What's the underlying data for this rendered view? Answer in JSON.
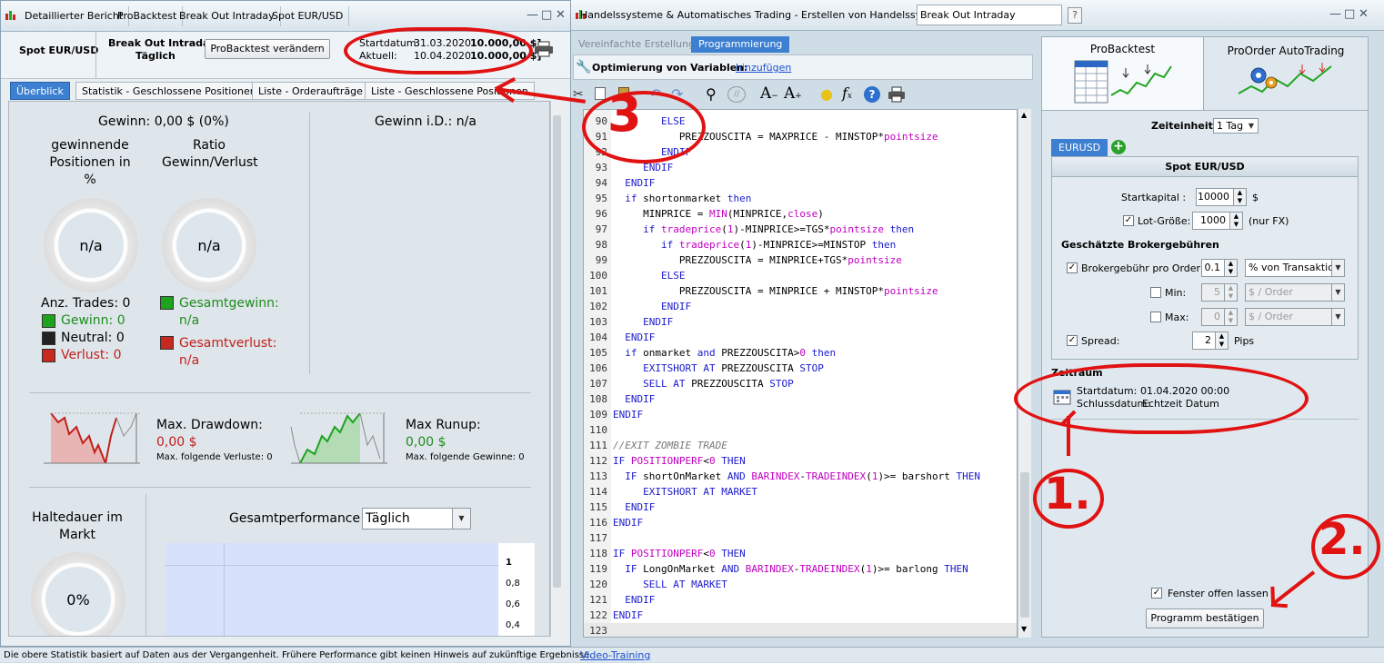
{
  "left_window": {
    "tabs": [
      "Detaillierter Bericht",
      "ProBacktest",
      "Break Out Intraday",
      "Spot EUR/USD"
    ],
    "instrument": "Spot EUR/USD",
    "system_name": "Break Out Intraday",
    "period": "Täglich",
    "modify_button": "ProBacktest verändern",
    "start_label": "Startdatum:",
    "start_value": "31.03.2020",
    "current_label": "Aktuell:",
    "current_value": "10.04.2020",
    "capital_1": "10.000,00 $]",
    "capital_2": "10.000,00 $]",
    "subtabs": [
      "Überblick",
      "Statistik - Geschlossene Positionen",
      "Liste - Orderaufträge",
      "Liste - Geschlossene Positionen"
    ],
    "gain": "Gewinn: 0,00 $ (0%)",
    "gain_id": "Gewinn i.D.: n/a",
    "winning_positions_l1": "gewinnende",
    "winning_positions_l2": "Positionen in",
    "winning_positions_l3": "%",
    "ratio_l1": "Ratio",
    "ratio_l2": "Gewinn/Verlust",
    "na": "n/a",
    "trades": "Anz. Trades: 0",
    "gewinn": "Gewinn: 0",
    "neutral": "Neutral: 0",
    "verlust": "Verlust: 0",
    "gesamtgewinn": "Gesamtgewinn:",
    "gesamtverlust": "Gesamtverlust:",
    "max_drawdown": "Max. Drawdown:",
    "drawdown_value": "0,00 $",
    "max_losses": "Max. folgende Verluste: 0",
    "max_runup": "Max Runup:",
    "runup_value": "0,00 $",
    "max_gains": "Max. folgende Gewinne: 0",
    "holding_l1": "Haltedauer im",
    "holding_l2": "Markt",
    "holding_value": "0%",
    "perf_label": "Gesamtperformance",
    "perf_select": "Täglich",
    "axis_ticks": [
      "1",
      "0,8",
      "0,6",
      "0,4"
    ]
  },
  "middle_window": {
    "title": "Handelssysteme & Automatisches Trading - Erstellen von Handelssystemen",
    "system_input": "Break Out Intraday",
    "tab_simple": "Vereinfachte Erstellung",
    "tab_programming": "Programmierung",
    "optimization_label": "Optimierung von Variablen:",
    "optimization_link": "hinzufügen",
    "code_lines": [
      {
        "n": "90",
        "t": [
          [
            "        ",
            ""
          ],
          [
            "ELSE",
            "kw"
          ]
        ]
      },
      {
        "n": "91",
        "t": [
          [
            "           PREZZOUSCITA = MAXPRICE - MINSTOP*",
            ""
          ],
          [
            "pointsize",
            "fn"
          ]
        ]
      },
      {
        "n": "92",
        "t": [
          [
            "        ",
            ""
          ],
          [
            "ENDIF",
            "kw"
          ]
        ]
      },
      {
        "n": "93",
        "t": [
          [
            "     ",
            ""
          ],
          [
            "ENDIF",
            "kw"
          ]
        ]
      },
      {
        "n": "94",
        "t": [
          [
            "  ",
            ""
          ],
          [
            "ENDIF",
            "kw"
          ]
        ]
      },
      {
        "n": "95",
        "t": [
          [
            "  ",
            ""
          ],
          [
            "if",
            "kw"
          ],
          [
            " shortonmarket ",
            ""
          ],
          [
            "then",
            "kw"
          ]
        ]
      },
      {
        "n": "96",
        "t": [
          [
            "     MINPRICE = ",
            ""
          ],
          [
            "MIN",
            "fn"
          ],
          [
            "(MINPRICE,",
            ""
          ],
          [
            "close",
            "fn"
          ],
          [
            ")",
            ""
          ]
        ]
      },
      {
        "n": "97",
        "t": [
          [
            "     ",
            ""
          ],
          [
            "if",
            "kw"
          ],
          [
            " ",
            ""
          ],
          [
            "tradeprice",
            "fn"
          ],
          [
            "(",
            ""
          ],
          [
            "1",
            "fn"
          ],
          [
            ")-MINPRICE>=TGS*",
            ""
          ],
          [
            "pointsize",
            "fn"
          ],
          [
            " ",
            ""
          ],
          [
            "then",
            "kw"
          ]
        ]
      },
      {
        "n": "98",
        "t": [
          [
            "        ",
            ""
          ],
          [
            "if",
            "kw"
          ],
          [
            " ",
            ""
          ],
          [
            "tradeprice",
            "fn"
          ],
          [
            "(",
            ""
          ],
          [
            "1",
            "fn"
          ],
          [
            ")-MINPRICE>=MINSTOP ",
            ""
          ],
          [
            "then",
            "kw"
          ]
        ]
      },
      {
        "n": "99",
        "t": [
          [
            "           PREZZOUSCITA = MINPRICE+TGS*",
            ""
          ],
          [
            "pointsize",
            "fn"
          ]
        ]
      },
      {
        "n": "100",
        "t": [
          [
            "        ",
            ""
          ],
          [
            "ELSE",
            "kw"
          ]
        ]
      },
      {
        "n": "101",
        "t": [
          [
            "           PREZZOUSCITA = MINPRICE + MINSTOP*",
            ""
          ],
          [
            "pointsize",
            "fn"
          ]
        ]
      },
      {
        "n": "102",
        "t": [
          [
            "        ",
            ""
          ],
          [
            "ENDIF",
            "kw"
          ]
        ]
      },
      {
        "n": "103",
        "t": [
          [
            "     ",
            ""
          ],
          [
            "ENDIF",
            "kw"
          ]
        ]
      },
      {
        "n": "104",
        "t": [
          [
            "  ",
            ""
          ],
          [
            "ENDIF",
            "kw"
          ]
        ]
      },
      {
        "n": "105",
        "t": [
          [
            "  ",
            ""
          ],
          [
            "if",
            "kw"
          ],
          [
            " onmarket ",
            ""
          ],
          [
            "and",
            "kw"
          ],
          [
            " PREZZOUSCITA>",
            ""
          ],
          [
            "0",
            "fn"
          ],
          [
            " ",
            ""
          ],
          [
            "then",
            "kw"
          ]
        ]
      },
      {
        "n": "106",
        "t": [
          [
            "     ",
            ""
          ],
          [
            "EXITSHORT AT",
            "kw"
          ],
          [
            " PREZZOUSCITA ",
            ""
          ],
          [
            "STOP",
            "kw"
          ]
        ]
      },
      {
        "n": "107",
        "t": [
          [
            "     ",
            ""
          ],
          [
            "SELL AT",
            "kw"
          ],
          [
            " PREZZOUSCITA ",
            ""
          ],
          [
            "STOP",
            "kw"
          ]
        ]
      },
      {
        "n": "108",
        "t": [
          [
            "  ",
            ""
          ],
          [
            "ENDIF",
            "kw"
          ]
        ]
      },
      {
        "n": "109",
        "t": [
          [
            "",
            ""
          ],
          [
            "ENDIF",
            "kw"
          ]
        ]
      },
      {
        "n": "110",
        "t": [
          [
            "",
            ""
          ]
        ]
      },
      {
        "n": "111",
        "t": [
          [
            "//EXIT ZOMBIE TRADE",
            "cm"
          ]
        ]
      },
      {
        "n": "112",
        "t": [
          [
            "IF",
            "kw"
          ],
          [
            " ",
            ""
          ],
          [
            "POSITIONPERF",
            "fn"
          ],
          [
            "<",
            ""
          ],
          [
            "0",
            "fn"
          ],
          [
            " ",
            ""
          ],
          [
            "THEN",
            "kw"
          ]
        ]
      },
      {
        "n": "113",
        "t": [
          [
            "  ",
            ""
          ],
          [
            "IF",
            "kw"
          ],
          [
            " shortOnMarket ",
            ""
          ],
          [
            "AND",
            "kw"
          ],
          [
            " ",
            ""
          ],
          [
            "BARINDEX",
            "fn"
          ],
          [
            "-",
            ""
          ],
          [
            "TRADEINDEX",
            "fn"
          ],
          [
            "(",
            ""
          ],
          [
            "1",
            "fn"
          ],
          [
            ")>= barshort ",
            ""
          ],
          [
            "THEN",
            "kw"
          ]
        ]
      },
      {
        "n": "114",
        "t": [
          [
            "     ",
            ""
          ],
          [
            "EXITSHORT AT MARKET",
            "kw"
          ]
        ]
      },
      {
        "n": "115",
        "t": [
          [
            "  ",
            ""
          ],
          [
            "ENDIF",
            "kw"
          ]
        ]
      },
      {
        "n": "116",
        "t": [
          [
            "",
            ""
          ],
          [
            "ENDIF",
            "kw"
          ]
        ]
      },
      {
        "n": "117",
        "t": [
          [
            "",
            ""
          ]
        ]
      },
      {
        "n": "118",
        "t": [
          [
            "IF",
            "kw"
          ],
          [
            " ",
            ""
          ],
          [
            "POSITIONPERF",
            "fn"
          ],
          [
            "<",
            ""
          ],
          [
            "0",
            "fn"
          ],
          [
            " ",
            ""
          ],
          [
            "THEN",
            "kw"
          ]
        ]
      },
      {
        "n": "119",
        "t": [
          [
            "  ",
            ""
          ],
          [
            "IF",
            "kw"
          ],
          [
            " LongOnMarket ",
            ""
          ],
          [
            "AND",
            "kw"
          ],
          [
            " ",
            ""
          ],
          [
            "BARINDEX",
            "fn"
          ],
          [
            "-",
            ""
          ],
          [
            "TRADEINDEX",
            "fn"
          ],
          [
            "(",
            ""
          ],
          [
            "1",
            "fn"
          ],
          [
            ")>= barlong ",
            ""
          ],
          [
            "THEN",
            "kw"
          ]
        ]
      },
      {
        "n": "120",
        "t": [
          [
            "     ",
            ""
          ],
          [
            "SELL AT MARKET",
            "kw"
          ]
        ]
      },
      {
        "n": "121",
        "t": [
          [
            "  ",
            ""
          ],
          [
            "ENDIF",
            "kw"
          ]
        ]
      },
      {
        "n": "122",
        "t": [
          [
            "",
            ""
          ],
          [
            "ENDIF",
            "kw"
          ]
        ]
      },
      {
        "n": "123",
        "t": [
          [
            "",
            ""
          ]
        ]
      }
    ]
  },
  "right_panel": {
    "tab_probacktest": "ProBacktest",
    "tab_autotrading": "ProOrder AutoTrading",
    "timeframe_label": "Zeiteinheit:",
    "timeframe_value": "1 Tag",
    "instrument_tab": "EURUSD",
    "instrument_title": "Spot EUR/USD",
    "startkapital_label": "Startkapital :",
    "startkapital_value": "10000",
    "currency": "$",
    "lot_label": "Lot-Größe:",
    "lot_value": "1000",
    "lot_note": "(nur FX)",
    "fees_title": "Geschätzte Brokergebühren",
    "fee_label": "Brokergebühr pro Order :",
    "fee_value": "0.1",
    "fee_type": "% von Transaktion",
    "min_label": "Min:",
    "min_value": "5",
    "min_unit": "$ / Order",
    "max_label": "Max:",
    "max_value": "0",
    "max_unit": "$ / Order",
    "spread_label": "Spread:",
    "spread_value": "2",
    "spread_unit": "Pips",
    "period_title": "Zeitraum",
    "start_label": "Startdatum:",
    "start_value": "01.04.2020 00:00",
    "end_label": "Schlussdatum:",
    "end_value": "Echtzeit Datum",
    "keep_open": "Fenster offen lassen",
    "confirm_button": "Programm bestätigen"
  },
  "status_bar": {
    "disclaimer": "Die obere Statistik basiert auf Daten aus der Vergangenheit. Frühere Performance gibt keinen Hinweis auf zukünftige Ergebnisse.",
    "video_link": "Video-Training"
  },
  "annotations": [
    "3",
    "1.",
    "2."
  ],
  "colors": {
    "accent": "#3d7fd1",
    "green": "#1e8c1e",
    "red": "#c0201c",
    "annotation": "#e01212"
  }
}
